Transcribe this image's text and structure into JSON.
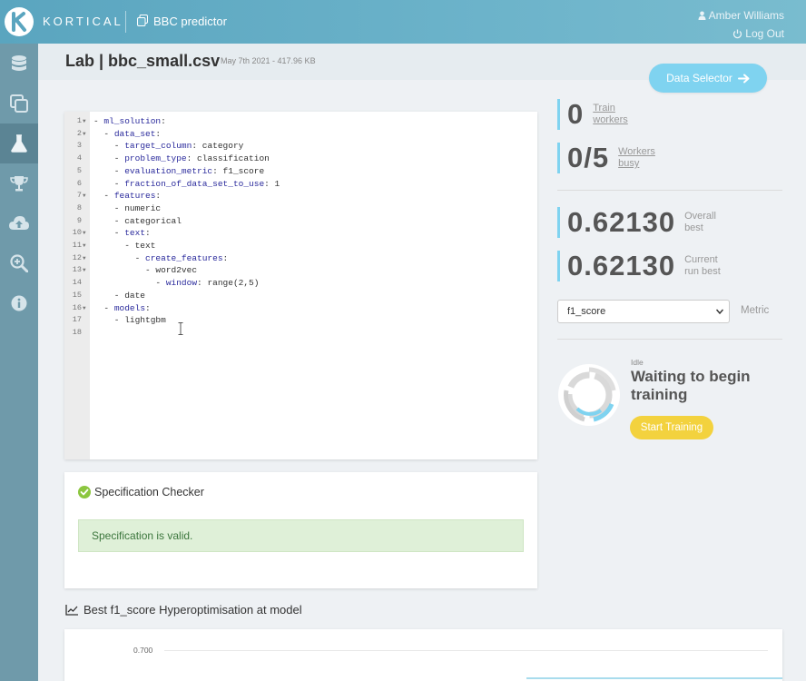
{
  "header": {
    "brand": "KORTICAL",
    "project_name": "BBC predictor",
    "user_name": "Amber Williams",
    "logout_label": "Log Out"
  },
  "sidebar": {
    "items": [
      {
        "icon": "database-icon"
      },
      {
        "icon": "copy-icon"
      },
      {
        "icon": "flask-icon",
        "active": true
      },
      {
        "icon": "trophy-icon"
      },
      {
        "icon": "cloud-upload-icon"
      },
      {
        "icon": "zoom-in-icon"
      },
      {
        "icon": "info-icon"
      }
    ]
  },
  "page": {
    "title": "Lab | bbc_small.csv",
    "file_meta": "May 7th 2021 - 417.96 KB",
    "data_selector_label": "Data Selector"
  },
  "editor": {
    "lines": [
      {
        "n": "1",
        "fold": true,
        "text": "- ml_solution:"
      },
      {
        "n": "2",
        "fold": true,
        "text": "  - data_set:"
      },
      {
        "n": "3",
        "fold": false,
        "text": "    - target_column: category"
      },
      {
        "n": "4",
        "fold": false,
        "text": "    - problem_type: classification"
      },
      {
        "n": "5",
        "fold": false,
        "text": "    - evaluation_metric: f1_score"
      },
      {
        "n": "6",
        "fold": false,
        "text": "    - fraction_of_data_set_to_use: 1"
      },
      {
        "n": "7",
        "fold": true,
        "text": "  - features:"
      },
      {
        "n": "8",
        "fold": false,
        "text": "    - numeric"
      },
      {
        "n": "9",
        "fold": false,
        "text": "    - categorical"
      },
      {
        "n": "10",
        "fold": true,
        "text": "    - text:"
      },
      {
        "n": "11",
        "fold": true,
        "text": "      - text"
      },
      {
        "n": "12",
        "fold": true,
        "text": "        - create_features:"
      },
      {
        "n": "13",
        "fold": true,
        "text": "          - word2vec"
      },
      {
        "n": "14",
        "fold": false,
        "text": "            - window: range(2,5)"
      },
      {
        "n": "15",
        "fold": false,
        "text": "    - date"
      },
      {
        "n": "16",
        "fold": true,
        "text": "  - models:"
      },
      {
        "n": "17",
        "fold": false,
        "text": "    - lightgbm"
      },
      {
        "n": "18",
        "fold": false,
        "text": ""
      }
    ]
  },
  "spec_checker": {
    "title": "Specification Checker",
    "message": "Specification is valid."
  },
  "stats": {
    "train_workers_value": "0",
    "train_workers_label_1": "Train",
    "train_workers_label_2": "workers",
    "workers_busy_value": "0/5",
    "workers_busy_label_1": "Workers",
    "workers_busy_label_2": "busy",
    "overall_best_value": "0.62130",
    "overall_best_label_1": "Overall",
    "overall_best_label_2": "best",
    "current_best_value": "0.62130",
    "current_best_label_1": "Current",
    "current_best_label_2": "run best"
  },
  "metric": {
    "selected": "f1_score",
    "label": "Metric"
  },
  "training": {
    "status": "Idle",
    "message": "Waiting to begin training",
    "start_label": "Start Training"
  },
  "chart": {
    "title": "Best f1_score Hyperoptimisation at model",
    "y_tick": "0.700"
  },
  "colors": {
    "accent": "#7fd3f0",
    "topbar": "#6cb3ca",
    "sidebar": "#6f9aaa",
    "start_button": "#f3d23e",
    "valid_bg": "#dff0d8"
  }
}
